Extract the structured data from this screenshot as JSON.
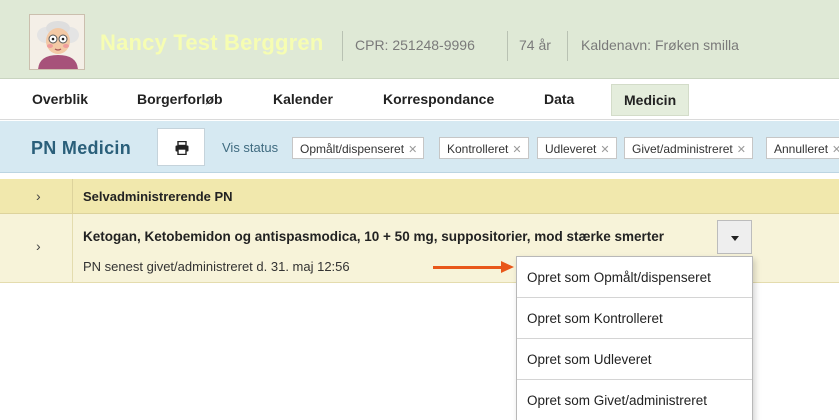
{
  "header": {
    "patient_name": "Nancy Test Berggren",
    "cpr": "CPR: 251248-9996",
    "age": "74 år",
    "nickname": "Kaldenavn: Frøken smilla"
  },
  "nav": {
    "items": [
      "Overblik",
      "Borgerforløb",
      "Kalender",
      "Korrespondance",
      "Data",
      "Medicin"
    ],
    "active": "Medicin"
  },
  "toolbar": {
    "title": "PN Medicin",
    "vis_status_label": "Vis status",
    "chips": [
      "Opmålt/dispenseret",
      "Kontrolleret",
      "Udleveret",
      "Givet/administreret",
      "Annulleret"
    ]
  },
  "rows": {
    "group_title": "Selvadministrerende PN",
    "item_title": "Ketogan, Ketobemidon og antispasmodica, 10 + 50 mg, suppositorier, mod stærke smerter",
    "item_subtitle": "PN senest givet/administreret d. 31. maj 12:56"
  },
  "menu": {
    "items": [
      "Opret som Opmålt/dispenseret",
      "Opret som Kontrolleret",
      "Opret som Udleveret",
      "Opret som Givet/administreret"
    ]
  },
  "colors": {
    "header_bg": "#dfe9d6",
    "name_color": "#f6fdb2",
    "toolbar_bg": "#d6e9f2",
    "group_row_bg": "#f1e8ad",
    "item_row_bg": "#f7f3d9",
    "annotation_arrow": "#e8571a"
  },
  "icons": {
    "avatar": "elderly-woman-avatar",
    "print": "print-icon",
    "chevron": "chevron-right-icon",
    "chip_remove": "close-icon",
    "dropdown": "caret-down-icon"
  }
}
